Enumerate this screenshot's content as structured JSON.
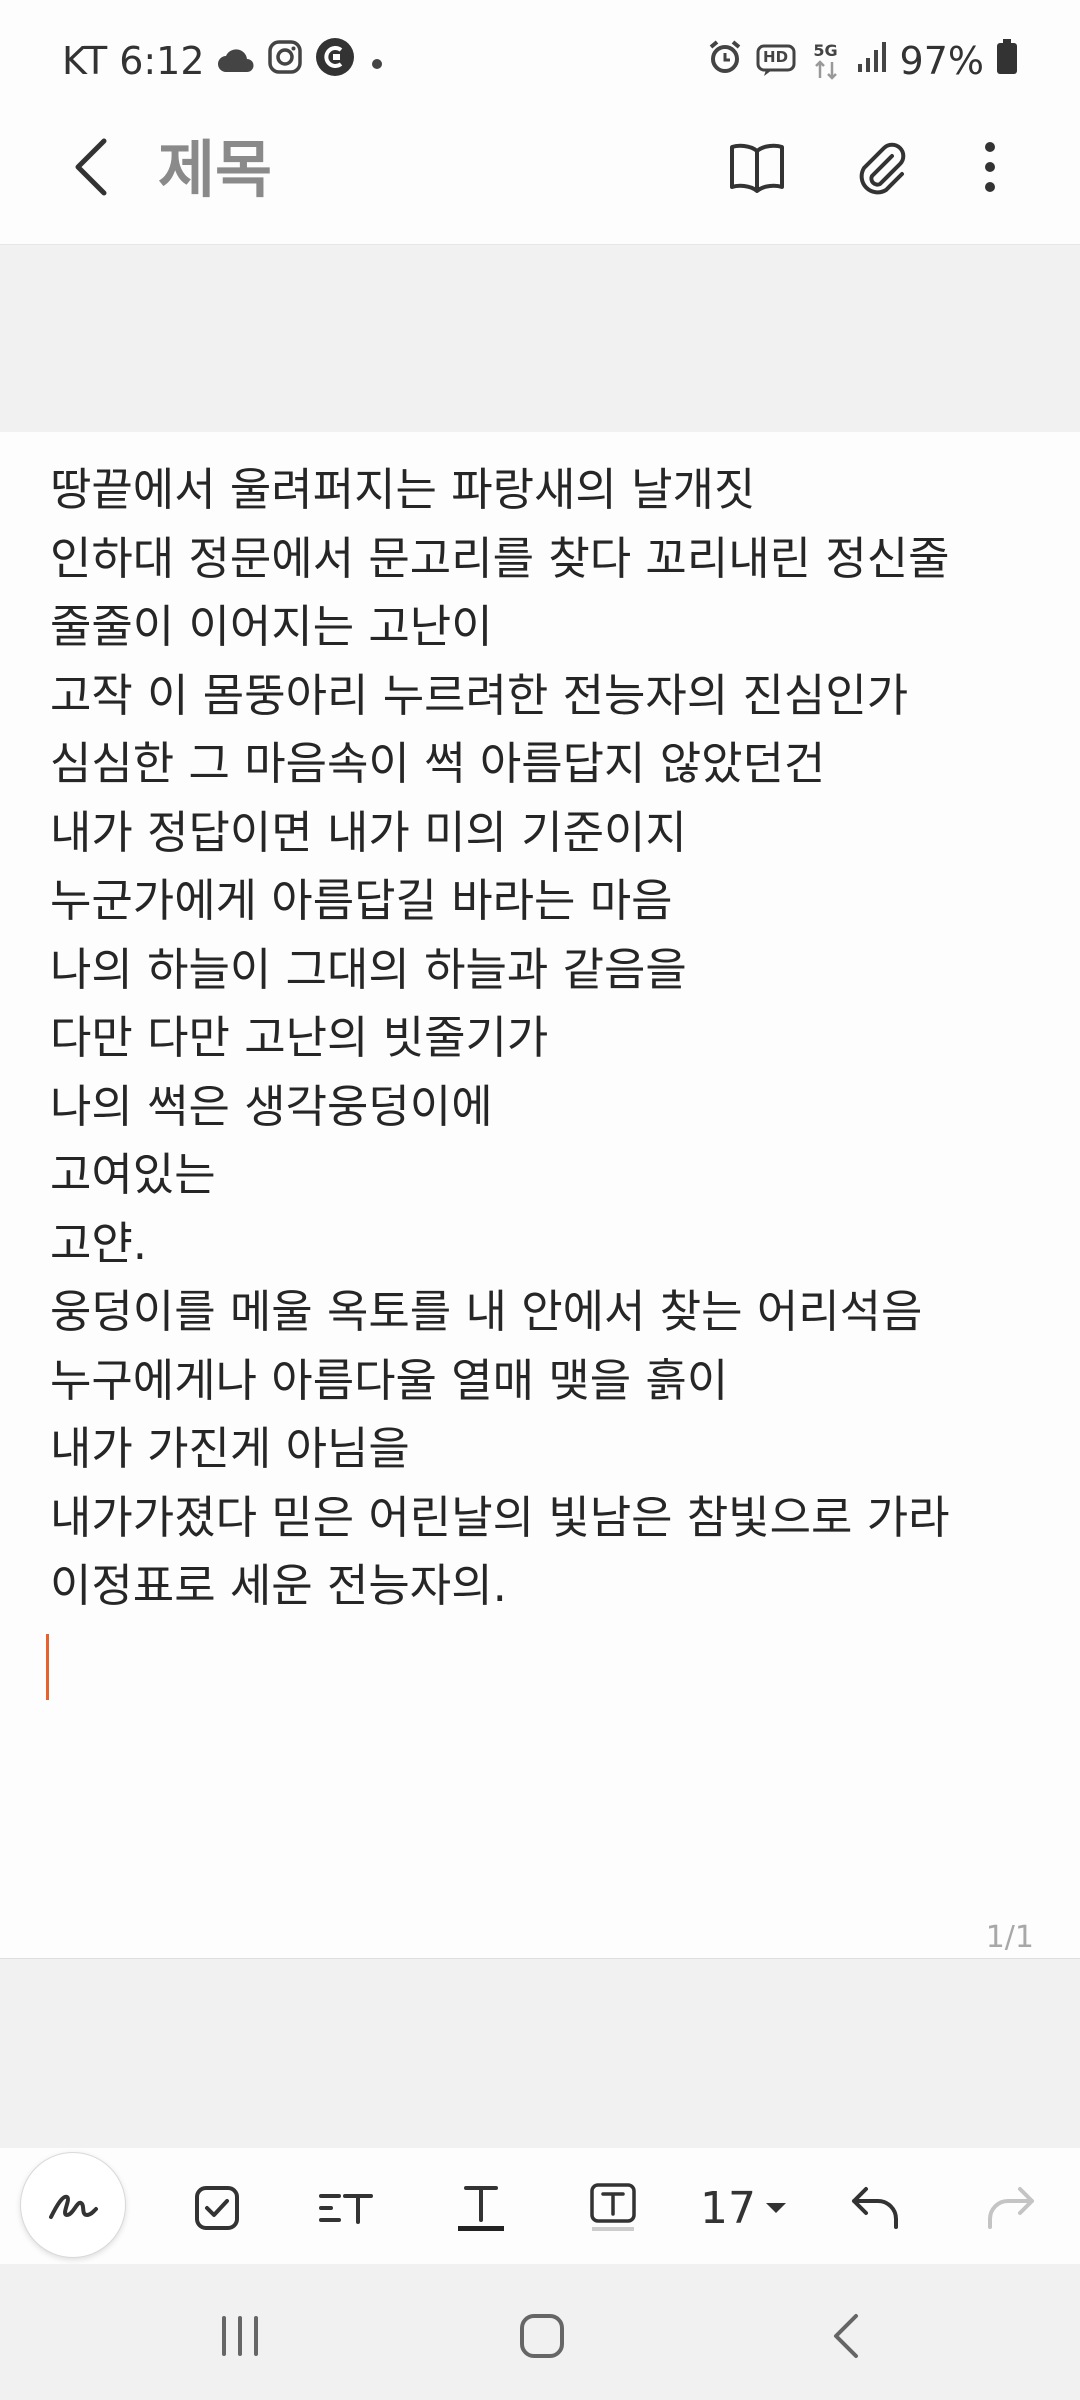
{
  "status_bar": {
    "carrier": "KT",
    "time": "6:12",
    "battery": "97%",
    "icons": [
      "cloud-icon",
      "instagram-icon",
      "app-c-icon",
      "dot-icon",
      "alarm-icon",
      "hd-icon",
      "5g-icon",
      "signal-icon",
      "battery-icon"
    ],
    "hd_label": "HD",
    "network_label": "5G"
  },
  "app_bar": {
    "title": "제목",
    "icons": [
      "back-icon",
      "reading-mode-icon",
      "attach-icon",
      "more-icon"
    ]
  },
  "note": {
    "lines": [
      "땅끝에서 울려퍼지는 파랑새의 날개짓",
      "인하대 정문에서 문고리를 찾다 꼬리내린 정신줄",
      "줄줄이 이어지는 고난이",
      "고작 이 몸뚱아리 누르려한 전능자의 진심인가",
      "심심한 그 마음속이 썩 아름답지 않았던건",
      "내가 정답이면 내가 미의 기준이지",
      "누군가에게 아름답길 바라는 마음",
      "나의 하늘이 그대의 하늘과 같음을",
      "다만 다만 고난의 빗줄기가",
      "나의 썩은 생각웅덩이에",
      "고여있는",
      "고얀.",
      "웅덩이를 메울 옥토를 내 안에서 찾는 어리석음",
      "누구에게나 아름다울 열매 맺을 흙이",
      "내가 가진게 아님을",
      "내가가졌다 믿은 어린날의 빛남은 참빛으로 가라",
      "이정표로 세운 전능자의."
    ],
    "page_indicator": "1/1",
    "cursor_color": "#e8612c"
  },
  "format_toolbar": {
    "font_size": "17",
    "icons": [
      "pen-icon",
      "checkbox-icon",
      "text-style-icon",
      "text-color-icon",
      "text-background-icon",
      "undo-icon",
      "redo-icon"
    ]
  },
  "nav_bar": {
    "icons": [
      "recents-icon",
      "home-icon",
      "back-nav-icon"
    ]
  },
  "colors": {
    "accent": "#e8612c",
    "title_gray": "#8a8a8a",
    "band_gray": "#f1f1f1"
  }
}
